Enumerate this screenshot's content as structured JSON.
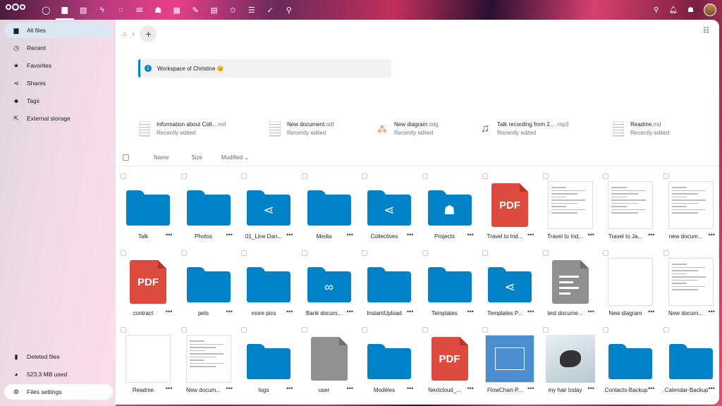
{
  "topbar": {
    "apps": [
      {
        "name": "dashboard",
        "glyph": "◯"
      },
      {
        "name": "files",
        "glyph": "▆"
      },
      {
        "name": "photos",
        "glyph": "▨"
      },
      {
        "name": "activity",
        "glyph": "ϟ"
      },
      {
        "name": "talk",
        "glyph": "◌"
      },
      {
        "name": "mail",
        "glyph": "✉"
      },
      {
        "name": "contacts",
        "glyph": "☗"
      },
      {
        "name": "calendar",
        "glyph": "▦"
      },
      {
        "name": "notes",
        "glyph": "✎"
      },
      {
        "name": "deck",
        "glyph": "▤"
      },
      {
        "name": "tasks-star",
        "glyph": "✩"
      },
      {
        "name": "list",
        "glyph": "☰"
      },
      {
        "name": "checkmark",
        "glyph": "✓"
      },
      {
        "name": "maps",
        "glyph": "⚲"
      }
    ]
  },
  "sidebar": {
    "items": [
      {
        "label": "All files",
        "icon": "▆"
      },
      {
        "label": "Recent",
        "icon": "◷"
      },
      {
        "label": "Favorites",
        "icon": "★"
      },
      {
        "label": "Shares",
        "icon": "⋖"
      },
      {
        "label": "Tags",
        "icon": "⬥"
      },
      {
        "label": "External storage",
        "icon": "⇱"
      }
    ],
    "bottom": [
      {
        "label": "Deleted files",
        "icon": "▮"
      },
      {
        "label": "523.3 MB used",
        "icon": "◕"
      },
      {
        "label": "Files settings",
        "icon": "⚙"
      }
    ]
  },
  "notice": {
    "text": "Workspace of Christine 😉"
  },
  "recent": [
    {
      "name": "Information about Coll...",
      "ext": ".md",
      "sub": "Recently edited",
      "icon": "doc"
    },
    {
      "name": "New document",
      "ext": ".odt",
      "sub": "Recently edited",
      "icon": "doc"
    },
    {
      "name": "New diagram",
      "ext": ".odg",
      "sub": "Recently edited",
      "icon": "diagram"
    },
    {
      "name": "Talk recording from 2...",
      "ext": " .mp3",
      "sub": "Recently edited",
      "icon": "audio"
    },
    {
      "name": "Readme",
      "ext": ".md",
      "sub": "Recently edited",
      "icon": "doc"
    }
  ],
  "columns": {
    "name": "Name",
    "size": "Size",
    "modified": "Modified"
  },
  "files": [
    {
      "label": "Talk",
      "type": "folder"
    },
    {
      "label": "Photos",
      "type": "folder"
    },
    {
      "label": "01_Line Dan...",
      "type": "folder-share"
    },
    {
      "label": "Media",
      "type": "folder"
    },
    {
      "label": "Collectives",
      "type": "folder-share"
    },
    {
      "label": "Projects",
      "type": "folder-group"
    },
    {
      "label": "Travel to Ind...",
      "type": "pdf",
      "pdf_text": "PDF"
    },
    {
      "label": "Travel to Ind...",
      "type": "paper"
    },
    {
      "label": "Travel to Ja...",
      "type": "paper"
    },
    {
      "label": "new docum...",
      "type": "paper"
    },
    {
      "label": "contract",
      "type": "pdf",
      "pdf_text": "PDF"
    },
    {
      "label": "pets",
      "type": "folder"
    },
    {
      "label": "more pics",
      "type": "folder"
    },
    {
      "label": "Bank docum...",
      "type": "folder-link"
    },
    {
      "label": "InstantUpload",
      "type": "folder"
    },
    {
      "label": "Templates",
      "type": "folder"
    },
    {
      "label": "Templates P...",
      "type": "folder-share"
    },
    {
      "label": "test docume...",
      "type": "greydoc"
    },
    {
      "label": "New diagram",
      "type": "blank"
    },
    {
      "label": "New docum...",
      "type": "paper"
    },
    {
      "label": "Readme",
      "type": "blank"
    },
    {
      "label": "New docum...",
      "type": "paper"
    },
    {
      "label": "logs",
      "type": "folder"
    },
    {
      "label": "user",
      "type": "greyfile"
    },
    {
      "label": "Modèles",
      "type": "folder"
    },
    {
      "label": "Nextcloud_...",
      "type": "pdf",
      "pdf_text": "PDF"
    },
    {
      "label": "FlowChart-P...",
      "type": "flow"
    },
    {
      "label": "my hair today",
      "type": "photo"
    },
    {
      "label": ".Contacts-Backup",
      "type": "folder"
    },
    {
      "label": ".Calendar-Backup",
      "type": "folder"
    }
  ]
}
